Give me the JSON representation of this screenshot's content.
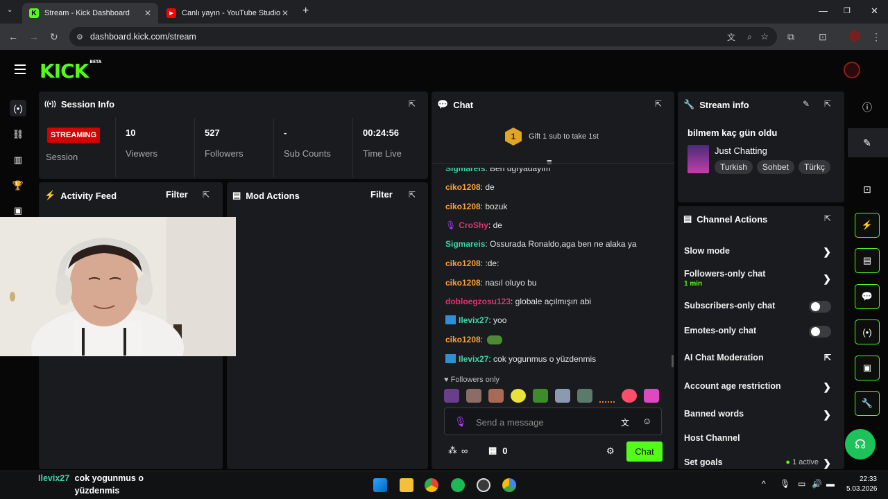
{
  "browser": {
    "tabs": [
      {
        "title": "Stream - Kick Dashboard",
        "active": true
      },
      {
        "title": "Canlı yayın - YouTube Studio",
        "active": false
      }
    ],
    "url": "dashboard.kick.com/stream"
  },
  "kick": {
    "logo": "KICK",
    "logo_badge": "BETA"
  },
  "session": {
    "title": "Session Info",
    "status_badge": "STREAMING",
    "status_label": "Session",
    "stats": [
      {
        "value": "10",
        "label": "Viewers"
      },
      {
        "value": "527",
        "label": "Followers"
      },
      {
        "value": "-",
        "label": "Sub Counts"
      },
      {
        "value": "00:24:56",
        "label": "Time Live"
      }
    ]
  },
  "activity": {
    "title": "Activity Feed",
    "filter": "Filter"
  },
  "mod": {
    "title": "Mod Actions",
    "filter": "Filter"
  },
  "chat": {
    "title": "Chat",
    "gift_count": "1",
    "gift_text": "Gift 1 sub to take 1st",
    "messages": [
      {
        "user": "Sigmareis",
        "text": ": Ben uğryadayım",
        "color": "#3fd5a5"
      },
      {
        "user": "ciko1208",
        "text": ": de",
        "color": "#ff9f33"
      },
      {
        "user": "ciko1208",
        "text": ": bozuk",
        "color": "#ff9f33"
      },
      {
        "user": "CroShy",
        "text": ": de",
        "color": "#e0336e"
      },
      {
        "user": "Sigmareis",
        "text": ": Ossurada Ronaldo,aga ben ne alaka ya",
        "color": "#3fd5a5"
      },
      {
        "user": "ciko1208",
        "text": ": :de:",
        "color": "#ff9f33"
      },
      {
        "user": "ciko1208",
        "text": ": nasıl oluyo bu",
        "color": "#ff9f33"
      },
      {
        "user": "dobloegzosu123",
        "text": ": globale açılmışın abi",
        "color": "#e0336e"
      },
      {
        "user": "Ilevix27",
        "text": ": yoo",
        "color": "#3fd5a5"
      },
      {
        "user": "ciko1208",
        "text": ":",
        "color": "#ff9f33"
      },
      {
        "user": "Ilevix27",
        "text": ": cok yogunmus o yüzdenmis",
        "color": "#3fd5a5"
      }
    ],
    "followers_only": "Followers only",
    "input_placeholder": "Send a message",
    "points_symbol": "∞",
    "store_count": "0",
    "send_button": "Chat"
  },
  "stream_info": {
    "title": "Stream info",
    "stream_title": "bilmem kaç gün oldu",
    "category": "Just Chatting",
    "tags": [
      "Turkish",
      "Sohbet",
      "Türkç"
    ]
  },
  "channel_actions": {
    "title": "Channel Actions",
    "items": [
      {
        "label": "Slow mode",
        "control": "chevron"
      },
      {
        "label": "Followers-only chat",
        "sub": "1 min",
        "control": "chevron"
      },
      {
        "label": "Subscribers-only chat",
        "control": "toggle"
      },
      {
        "label": "Emotes-only chat",
        "control": "toggle"
      },
      {
        "label": "AI Chat Moderation",
        "control": "external"
      },
      {
        "label": "Account age restriction",
        "control": "chevron"
      },
      {
        "label": "Banned words",
        "control": "chevron"
      },
      {
        "label": "Host Channel",
        "control": "none"
      },
      {
        "label": "Set goals",
        "status": "1 active",
        "control": "chevron"
      }
    ]
  },
  "overlay_chat": {
    "user": "Ilevix27",
    "text": "cok yogunmus o yüzdenmis"
  },
  "clock": {
    "time": "22:33",
    "date": "5.03.2026"
  },
  "colors": {
    "kick_green": "#53fc18",
    "panel": "#191b1f",
    "live_red": "#d50000"
  }
}
